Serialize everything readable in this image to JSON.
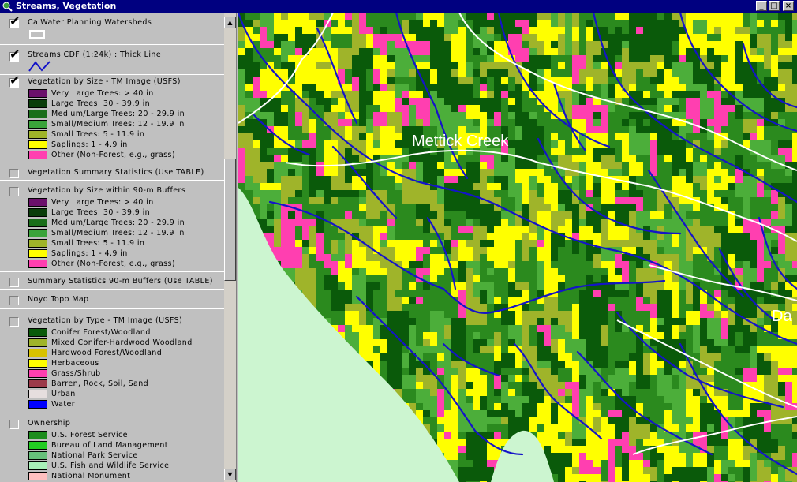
{
  "window": {
    "title": "Streams, Vegetation"
  },
  "legend": {
    "themes": {
      "watersheds": {
        "label": "CalWater Planning Watersheds",
        "checked": true
      },
      "streams": {
        "label": "Streams CDF (1:24k) : Thick Line",
        "checked": true
      },
      "veg_size": {
        "label": "Vegetation by Size - TM Image (USFS)",
        "checked": true,
        "classes": [
          {
            "label": "Very Large Trees: > 40  in",
            "color": "#6b0f6b"
          },
          {
            "label": "Large Trees: 30 - 39.9 in",
            "color": "#0a3d0a"
          },
          {
            "label": "Medium/Large Trees: 20 - 29.9 in",
            "color": "#1a6e1a"
          },
          {
            "label": "Small/Medium Trees: 12 - 19.9 in",
            "color": "#3aa33a"
          },
          {
            "label": "Small Trees: 5 - 11.9 in",
            "color": "#9fb42a"
          },
          {
            "label": "Saplings: 1 - 4.9 in",
            "color": "#ffff00"
          },
          {
            "label": "Other (Non-Forest, e.g., grass)",
            "color": "#ff3fb0"
          }
        ]
      },
      "veg_summary": {
        "label": "Vegetation Summary Statistics (Use TABLE)",
        "checked": false
      },
      "veg_buffers": {
        "label": "Vegetation by Size within 90-m Buffers",
        "checked": false,
        "classes": [
          {
            "label": "Very Large Trees: > 40  in",
            "color": "#6b0f6b"
          },
          {
            "label": "Large Trees: 30 - 39.9 in",
            "color": "#0a3d0a"
          },
          {
            "label": "Medium/Large Trees: 20 - 29.9 in",
            "color": "#1a6e1a"
          },
          {
            "label": "Small/Medium Trees: 12 - 19.9 in",
            "color": "#3aa33a"
          },
          {
            "label": "Small Trees: 5 - 11.9 in",
            "color": "#9fb42a"
          },
          {
            "label": "Saplings: 1 - 4.9 in",
            "color": "#ffff00"
          },
          {
            "label": "Other (Non-Forest, e.g., grass)",
            "color": "#ff3fb0"
          }
        ]
      },
      "buffer_summary": {
        "label": "Summary Statistics 90-m Buffers (Use TABLE)",
        "checked": false
      },
      "noyo_topo": {
        "label": "Noyo Topo Map",
        "checked": false
      },
      "veg_type": {
        "label": "Vegetation by Type - TM Image (USFS)",
        "checked": false,
        "classes": [
          {
            "label": "Conifer Forest/Woodland",
            "color": "#0a5a0a"
          },
          {
            "label": "Mixed Conifer-Hardwood Woodland",
            "color": "#9fb42a"
          },
          {
            "label": "Hardwood Forest/Woodland",
            "color": "#d8c200"
          },
          {
            "label": "Herbaceous",
            "color": "#ffff00"
          },
          {
            "label": "Grass/Shrub",
            "color": "#ff3fb0"
          },
          {
            "label": "Barren, Rock, Soil, Sand",
            "color": "#9c3a4a"
          },
          {
            "label": "Urban",
            "color": "#e6dede"
          },
          {
            "label": "Water",
            "color": "#0000ff"
          }
        ]
      },
      "ownership": {
        "label": "Ownership",
        "checked": false,
        "classes": [
          {
            "label": "U.S. Forest Service",
            "color": "#1c8c1c"
          },
          {
            "label": "Bureau of Land Management",
            "color": "#22cc22"
          },
          {
            "label": "National Park Service",
            "color": "#66c07a"
          },
          {
            "label": "U.S. Fish and Wildlife Service",
            "color": "#a8f0b8"
          },
          {
            "label": "National Monument",
            "color": "#ffc0c0"
          }
        ]
      }
    }
  },
  "map": {
    "labels": {
      "creek": "Mettick Creek",
      "partial": "Da"
    },
    "colors": {
      "background": "#ccf5d0",
      "large": "#0a5a0a",
      "medium": "#2b8a1e",
      "small_medium": "#4cae3a",
      "small": "#9fb42a",
      "saplings": "#ffff00",
      "other": "#ff3fb0",
      "streams": "#1414c8",
      "watershed": "#ffffff"
    }
  }
}
